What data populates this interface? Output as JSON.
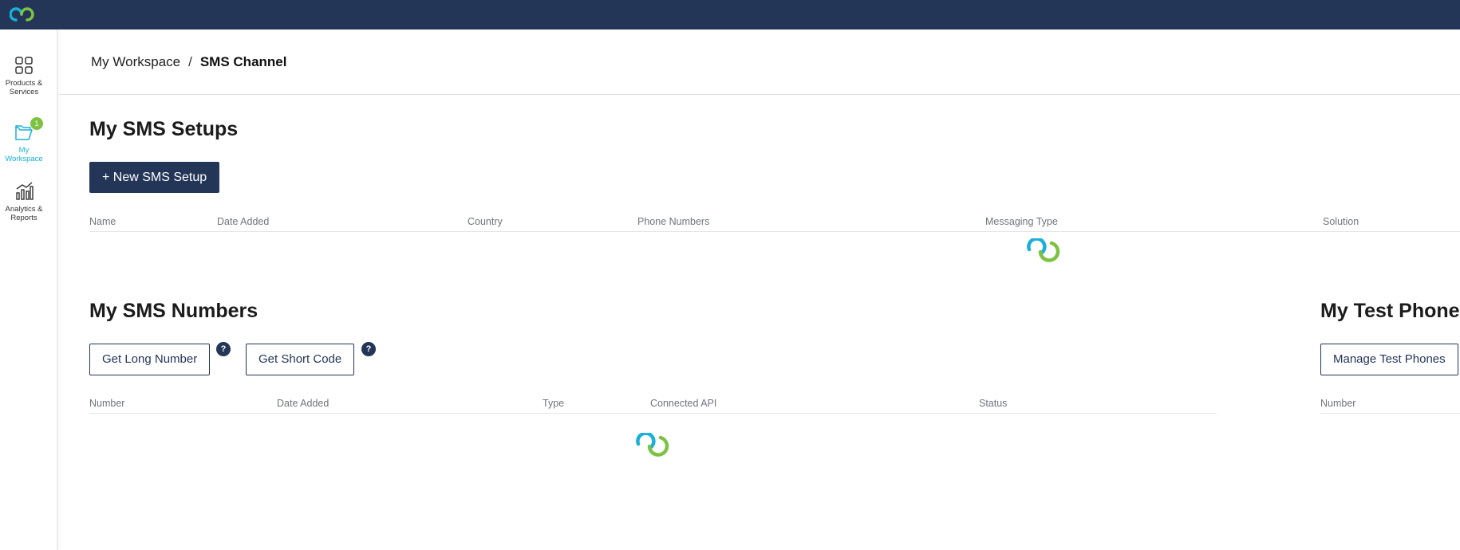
{
  "sidebar": {
    "items": [
      {
        "label": "Products & Services",
        "icon": "grid-icon"
      },
      {
        "label": "My Workspace",
        "icon": "folder-icon",
        "badge": "1"
      },
      {
        "label": "Analytics & Reports",
        "icon": "bar-chart-icon"
      }
    ]
  },
  "breadcrumb": {
    "parent": "My Workspace",
    "separator": "/",
    "current": "SMS Channel"
  },
  "setups": {
    "title": "My SMS Setups",
    "new_button": "+ New SMS Setup",
    "columns": [
      "Name",
      "Date Added",
      "Country",
      "Phone Numbers",
      "Messaging Type",
      "Solution"
    ]
  },
  "numbers": {
    "title": "My SMS Numbers",
    "long_button": "Get Long Number",
    "short_button": "Get Short Code",
    "help_label": "?",
    "columns": [
      "Number",
      "Date Added",
      "Type",
      "Connected API",
      "Status"
    ]
  },
  "test_phones": {
    "title": "My Test Phones",
    "manage_button": "Manage Test Phones",
    "columns": [
      "Number"
    ]
  },
  "colors": {
    "navy": "#243658",
    "accent_blue": "#1ab0d8",
    "accent_green": "#7dc242"
  }
}
